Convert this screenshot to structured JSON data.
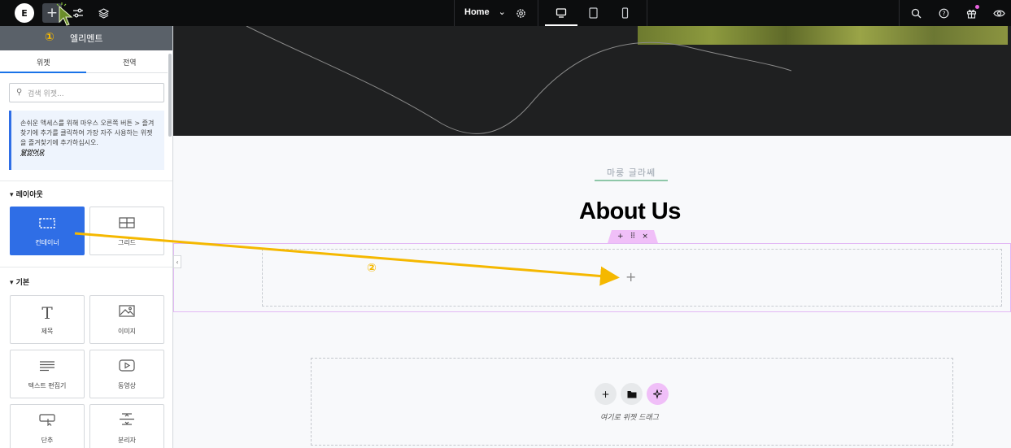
{
  "topbar": {
    "logo": "E",
    "add_icon": "plus-icon",
    "site_settings_icon": "sliders-icon",
    "structure_icon": "layers-icon",
    "page_selector": "Home",
    "settings_icon": "gear-icon",
    "devices": [
      "desktop-icon",
      "tablet-icon",
      "mobile-icon"
    ],
    "right_icons": [
      "search-icon",
      "help-icon",
      "gift-icon",
      "eye-icon"
    ]
  },
  "sidebar": {
    "title": "엘리멘트",
    "tabs": [
      {
        "label": "위젯",
        "active": true
      },
      {
        "label": "전역",
        "active": false
      }
    ],
    "search": {
      "placeholder": "검색 위젯..."
    },
    "notice": {
      "text": "손쉬운 액세스를 위해 마우스 오른쪽 버튼 > 즐겨찾기에 추가를 클릭하여 가장 자주 사용하는 위젯을 즐겨찾기에 추가하십시오.",
      "link": "알았어요"
    },
    "sections": [
      {
        "label": "레이아웃",
        "tiles": [
          {
            "label": "컨테이너",
            "icon": "container-icon",
            "selected": true
          },
          {
            "label": "그리드",
            "icon": "grid-icon",
            "selected": false
          }
        ]
      },
      {
        "label": "기본",
        "tiles": [
          {
            "label": "제목",
            "icon": "heading-icon",
            "selected": false
          },
          {
            "label": "이미지",
            "icon": "image-icon",
            "selected": false
          },
          {
            "label": "텍스트 편집기",
            "icon": "text-editor-icon",
            "selected": false
          },
          {
            "label": "동영상",
            "icon": "video-icon",
            "selected": false
          },
          {
            "label": "단추",
            "icon": "button-icon",
            "selected": false
          },
          {
            "label": "분리자",
            "icon": "divider-icon",
            "selected": false
          }
        ]
      }
    ]
  },
  "canvas": {
    "subtitle": "마룽 글라쎄",
    "heading": "About Us",
    "section_handle": [
      "+",
      "⠿",
      "×"
    ],
    "add_placeholder": "+",
    "drop_zone": {
      "buttons": [
        "+",
        "folder-icon",
        "ai-sparkle-icon"
      ],
      "label": "여기로 위젯 드래그"
    }
  },
  "annotations": {
    "step1": "①",
    "step2": "②",
    "arrow_color": "#f5b800"
  },
  "colors": {
    "accent": "#2f6ee6",
    "topbar": "#0c0d0e",
    "section_outline": "#e3b8f5",
    "handle": "#f0bff8"
  }
}
